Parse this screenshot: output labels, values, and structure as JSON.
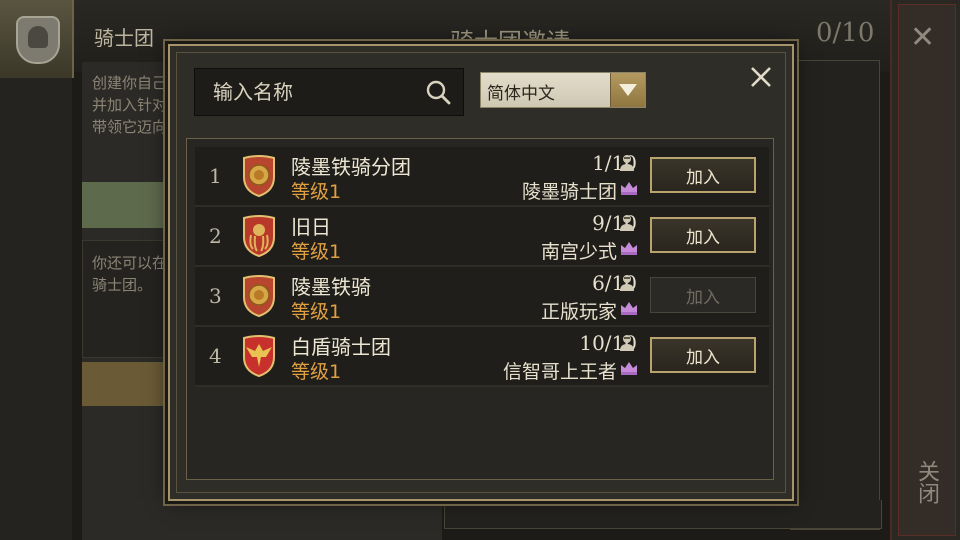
{
  "background": {
    "tab_label": "骑士团",
    "title": "骑士团邀请",
    "count": "0/10",
    "left_text_1": "创建你自己\n并加入针对\n带领它迈向",
    "left_text_2": "你还可以在\n骑士团。",
    "close_label": "关闭"
  },
  "search": {
    "placeholder": "输入名称",
    "value": ""
  },
  "language": {
    "selected": "简体中文"
  },
  "guilds": [
    {
      "rank": "1",
      "name": "陵墨铁骑分团",
      "level": "等级1",
      "members": "1/10",
      "leader": "陵墨骑士团",
      "emblem": "lion",
      "join_label": "加入",
      "join_enabled": true
    },
    {
      "rank": "2",
      "name": "旧日",
      "level": "等级1",
      "members": "9/10",
      "leader": "南宫少式",
      "emblem": "kraken",
      "join_label": "加入",
      "join_enabled": true
    },
    {
      "rank": "3",
      "name": "陵墨铁骑",
      "level": "等级1",
      "members": "6/10",
      "leader": "正版玩家",
      "emblem": "lion",
      "join_label": "加入",
      "join_enabled": false
    },
    {
      "rank": "4",
      "name": "白盾骑士团",
      "level": "等级1",
      "members": "10/10",
      "leader": "信智哥上王者",
      "emblem": "eagle",
      "join_label": "加入",
      "join_enabled": true
    }
  ],
  "colors": {
    "accent_gold": "#b9a46e",
    "level_orange": "#e0a040",
    "crown_purple": "#c58ad8"
  }
}
